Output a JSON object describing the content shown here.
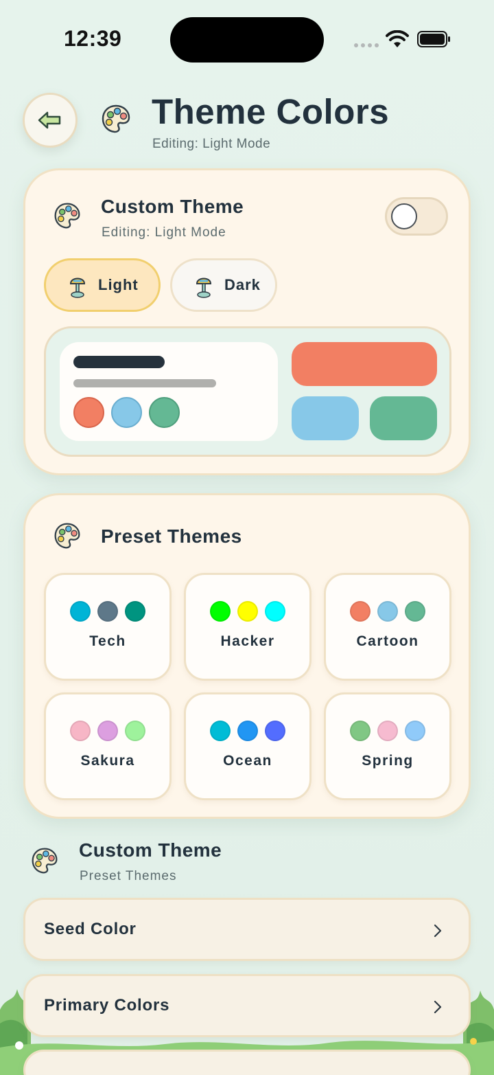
{
  "status_bar": {
    "time": "12:39"
  },
  "header": {
    "title": "Theme Colors",
    "subtitle": "Editing: Light Mode"
  },
  "custom_card": {
    "title": "Custom Theme",
    "subtitle": "Editing: Light Mode",
    "toggle_on": false,
    "modes": {
      "light": "Light",
      "dark": "Dark"
    },
    "selected_mode": "Light",
    "preview_colors": {
      "dark": "#26323c",
      "grey": "#b0b0ad",
      "coral": "#f27f63",
      "sky": "#87c8e8",
      "green": "#64b894"
    }
  },
  "presets_card": {
    "title": "Preset Themes",
    "presets": [
      {
        "name": "Tech",
        "colors": [
          "#00b4d6",
          "#5e7889",
          "#009480"
        ]
      },
      {
        "name": "Hacker",
        "colors": [
          "#00ff00",
          "#ffff00",
          "#00ffff"
        ]
      },
      {
        "name": "Cartoon",
        "colors": [
          "#f27f63",
          "#87c8e8",
          "#64b894"
        ]
      },
      {
        "name": "Sakura",
        "colors": [
          "#f7b6c6",
          "#dc9fe0",
          "#9ef29c"
        ]
      },
      {
        "name": "Ocean",
        "colors": [
          "#00bcd6",
          "#2196f3",
          "#536dfe"
        ]
      },
      {
        "name": "Spring",
        "colors": [
          "#80c784",
          "#f6bbd0",
          "#90caf9"
        ]
      }
    ]
  },
  "custom_section": {
    "title": "Custom Theme",
    "subtitle": "Preset Themes"
  },
  "rows": {
    "seed": "Seed Color",
    "primary": "Primary Colors"
  }
}
